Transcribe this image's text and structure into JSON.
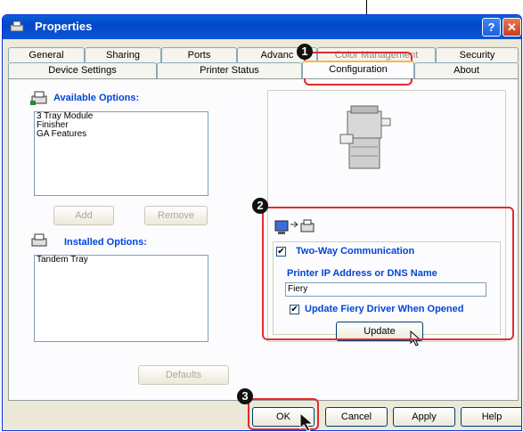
{
  "window": {
    "title": "Properties",
    "help_glyph": "?",
    "close_glyph": "✕"
  },
  "tabs_row1": [
    "General",
    "Sharing",
    "Ports",
    "Advanc",
    "Color Management",
    "Security"
  ],
  "tabs_row2": [
    "Device Settings",
    "Printer Status",
    "Configuration",
    "About"
  ],
  "active_tab": "Configuration",
  "available": {
    "label": "Available Options:",
    "items": [
      "3 Tray Module",
      "Finisher",
      "GA Features"
    ]
  },
  "buttons": {
    "add": "Add",
    "remove": "Remove",
    "defaults": "Defaults",
    "update": "Update",
    "ok": "OK",
    "cancel": "Cancel",
    "apply": "Apply",
    "help": "Help"
  },
  "installed": {
    "label": "Installed Options:",
    "items": [
      "Tandem Tray"
    ]
  },
  "two_way": {
    "label": "Two-Way Communication",
    "checked": "✔",
    "ip_label": "Printer IP Address or DNS Name",
    "ip_value": "Fiery",
    "update_fiery_label": "Update Fiery Driver When Opened",
    "update_checked": "✔"
  },
  "callouts": [
    "1",
    "2",
    "3"
  ],
  "colors": {
    "accent_red": "#e32c2b",
    "title_blue": "#0347c9",
    "label_blue": "#0046d5"
  }
}
